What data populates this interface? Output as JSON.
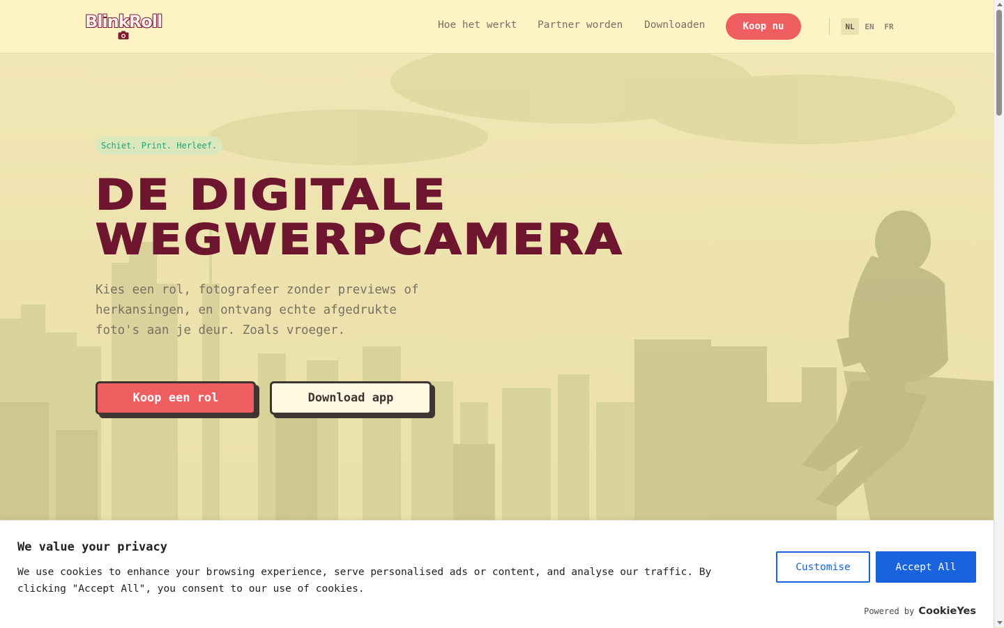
{
  "header": {
    "logo_text": "BlinkRoll",
    "nav": [
      "Hoe het werkt",
      "Partner worden",
      "Downloaden"
    ],
    "buy_label": "Koop nu",
    "languages": [
      "NL",
      "EN",
      "FR"
    ],
    "active_language": "NL"
  },
  "hero": {
    "tagline": "Schiet. Print. Herleef.",
    "title_line1": "DE DIGITALE",
    "title_line2": "WEGWERPCAMERA",
    "subtitle": "Kies een rol, fotografeer zonder previews of herkansingen, en ontvang echte afgedrukte foto's aan je deur. Zoals vroeger.",
    "primary_button": "Koop een rol",
    "secondary_button": "Download app"
  },
  "cookie_banner": {
    "title": "We value your privacy",
    "text": "We use cookies to enhance your browsing experience, serve personalised ads or content, and analyse our traffic. By clicking \"Accept All\", you consent to our use of cookies.",
    "customise_label": "Customise",
    "accept_label": "Accept All",
    "powered_by": "Powered by",
    "brand": "CookieYes"
  },
  "colors": {
    "brand": "#6e1630",
    "accent": "#ee5d60",
    "header_bg": "#fdf3c5",
    "tagline_text": "#23a36f",
    "cookie_blue": "#1863dc"
  },
  "icons": {
    "logo_camera": "camera-icon",
    "scroll_up": "chevron-up-icon",
    "scroll_down": "chevron-down-icon"
  }
}
